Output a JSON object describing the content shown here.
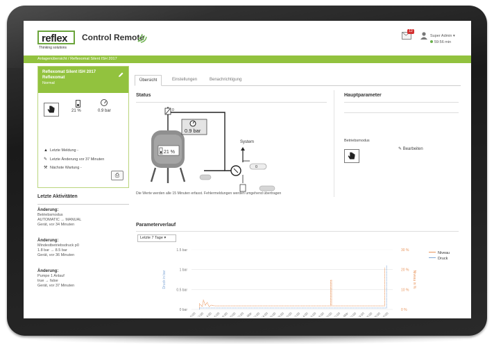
{
  "header": {
    "logo_text": "reflex",
    "logo_tagline": "Thinking solutions",
    "app_title": "Control Remote",
    "mail_badge": "12",
    "user_name": "Super Admin",
    "timer": "59:56 min"
  },
  "breadcrumb": "Anlagenübersicht  /  Reflexomat Silent ISH 2017",
  "device": {
    "name": "Reflexomat Silent ISH 2017",
    "type": "Reflexomat",
    "state": "Normal",
    "level": "21 %",
    "pressure": "0.9 bar",
    "last_message": "Letzte Meldung -",
    "last_change": "Letzte Änderung vor 37 Minuten",
    "next_service": "Nächste Wartung -"
  },
  "activities": {
    "title": "Letzte Aktivitäten",
    "items": [
      {
        "heading": "Änderung:",
        "field": "Betriebsmodus",
        "change": "AUTOMATIC → MANUAL",
        "meta": "Gerät, vor 34 Minuten"
      },
      {
        "heading": "Änderung:",
        "field": "Mindestbetriebsdruck p0",
        "change": "1.8 bar → 8.5 bar",
        "meta": "Gerät, vor 36 Minuten"
      },
      {
        "heading": "Änderung:",
        "field": "Pumpe 1 Anlauf",
        "change": "true → false",
        "meta": "Gerät, vor 37 Minuten"
      }
    ]
  },
  "tabs": [
    "Übersicht",
    "Einstellungen",
    "Benachrichtigung"
  ],
  "status": {
    "title": "Status",
    "tank_level": "21 %",
    "pressure": "0.9 bar",
    "system_label": "System",
    "valve_value": "0",
    "flow_value": "0",
    "note": "Die Werte werden alle 15 Minuten erfasst. Fehlermeldungen werden umgehend übertragen"
  },
  "main_params": {
    "title": "Hauptparameter",
    "mode_label": "Betriebsmodus",
    "edit_label": "Bearbeiten"
  },
  "history": {
    "title": "Parameterverlauf",
    "range": "Letzte 7 Tage"
  },
  "chart_data": {
    "type": "line",
    "ylabel_left": "Druck in bar",
    "ylabel_right": "Niveau in %",
    "left_ticks": [
      "0 bar",
      "0.5 bar",
      "1 bar",
      "1.5 bar"
    ],
    "right_ticks": [
      "0 %",
      "10 %",
      "20 %",
      "30 %"
    ],
    "ylim_left": [
      0,
      1.5
    ],
    "ylim_right": [
      0,
      30
    ],
    "x_ticks": [
      "10:00",
      "12:00",
      "14:00",
      "16:00",
      "18:00",
      "20:00",
      "22:00",
      "12. Mär",
      "02:00",
      "04:00",
      "06:00",
      "08:00",
      "10:00",
      "12:00",
      "14:00",
      "16:00",
      "18:00",
      "20:00",
      "22:00",
      "13. Mär",
      "02:00",
      "04:00",
      "06:00",
      "08:00",
      "10:00"
    ],
    "series": [
      {
        "name": "Niveau",
        "color": "#e8935a"
      },
      {
        "name": "Druck",
        "color": "#7fa6d6"
      }
    ]
  }
}
